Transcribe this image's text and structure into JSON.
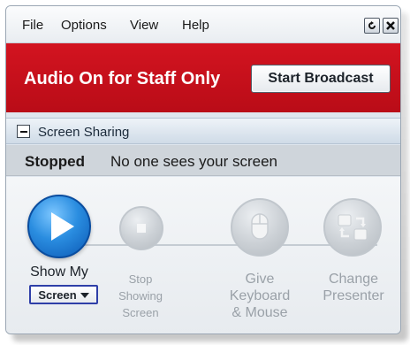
{
  "menu": {
    "file": "File",
    "options": "Options",
    "view": "View",
    "help": "Help"
  },
  "window_controls": {
    "restore_icon": "restore-icon",
    "close_icon": "close-icon"
  },
  "banner": {
    "text": "Audio On for Staff Only",
    "broadcast_button": "Start Broadcast",
    "background_color": "#c8101c"
  },
  "section": {
    "title": "Screen Sharing",
    "toggle_icon": "minus-icon"
  },
  "status": {
    "label": "Stopped",
    "message": "No one sees your screen"
  },
  "actions": {
    "show": {
      "line1": "Show My",
      "dropdown": "Screen",
      "icon": "play-icon"
    },
    "stop": {
      "line1": "Stop",
      "line2": "Showing",
      "line3": "Screen",
      "icon": "stop-icon"
    },
    "keyboard": {
      "line1": "Give",
      "line2": "Keyboard",
      "line3": "& Mouse",
      "icon": "mouse-icon"
    },
    "presenter": {
      "line1": "Change",
      "line2": "Presenter",
      "icon": "change-presenter-icon"
    }
  }
}
